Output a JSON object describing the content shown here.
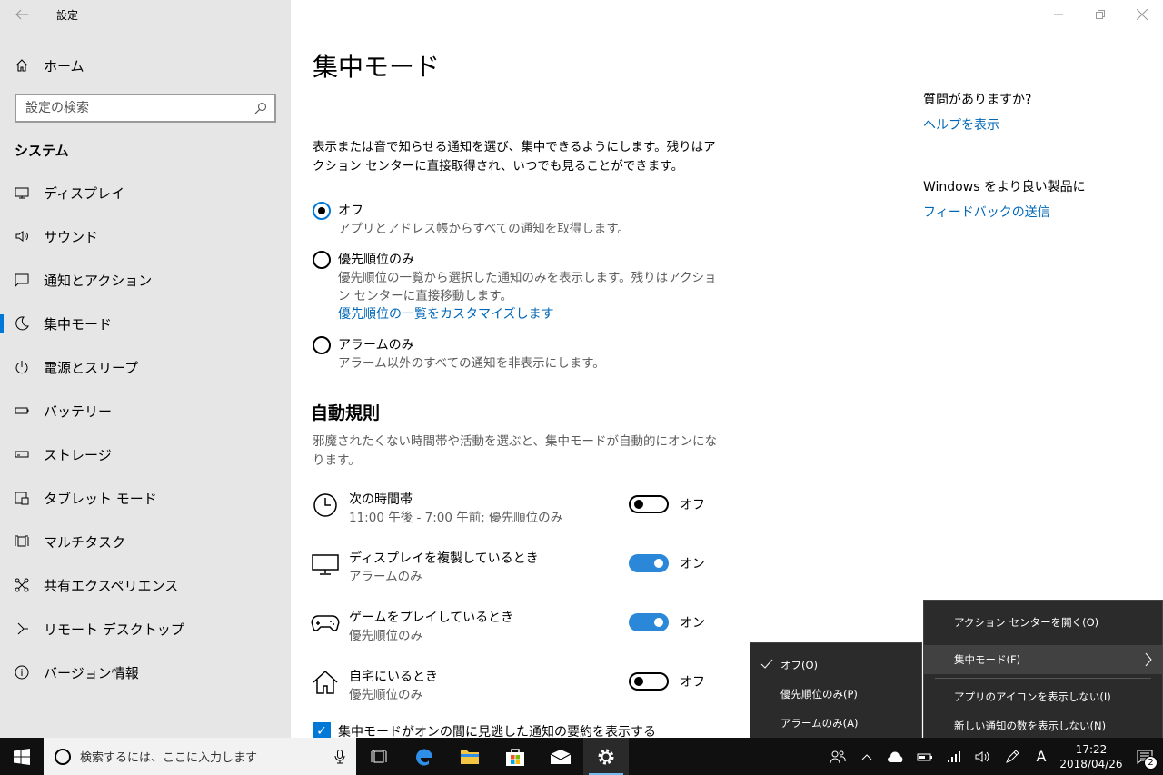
{
  "app": {
    "title": "設定"
  },
  "sidebar": {
    "home_label": "ホーム",
    "search_placeholder": "設定の検索",
    "section": "システム",
    "items": [
      {
        "label": "ディスプレイ",
        "icon": "display-icon"
      },
      {
        "label": "サウンド",
        "icon": "speaker-icon"
      },
      {
        "label": "通知とアクション",
        "icon": "message-icon"
      },
      {
        "label": "集中モード",
        "icon": "moon-icon",
        "active": true
      },
      {
        "label": "電源とスリープ",
        "icon": "power-icon"
      },
      {
        "label": "バッテリー",
        "icon": "battery-icon"
      },
      {
        "label": "ストレージ",
        "icon": "storage-icon"
      },
      {
        "label": "タブレット モード",
        "icon": "tablet-icon"
      },
      {
        "label": "マルチタスク",
        "icon": "multitask-icon"
      },
      {
        "label": "共有エクスペリエンス",
        "icon": "share-icon"
      },
      {
        "label": "リモート デスクトップ",
        "icon": "remote-icon"
      },
      {
        "label": "バージョン情報",
        "icon": "info-icon"
      }
    ]
  },
  "main": {
    "title": "集中モード",
    "description": "表示または音で知らせる通知を選び、集中できるようにします。残りはアクション センターに直接取得され、いつでも見ることができます。",
    "options": [
      {
        "label": "オフ",
        "sub": "アプリとアドレス帳からすべての通知を取得します。",
        "checked": true
      },
      {
        "label": "優先順位のみ",
        "sub": "優先順位の一覧から選択した通知のみを表示します。残りはアクション センターに直接移動します。",
        "link": "優先順位の一覧をカスタマイズします"
      },
      {
        "label": "アラームのみ",
        "sub": "アラーム以外のすべての通知を非表示にします。"
      }
    ],
    "auto_rules_title": "自動規則",
    "auto_rules_desc": "邪魔されたくない時間帯や活動を選ぶと、集中モードが自動的にオンになります。",
    "rules": [
      {
        "label": "次の時間帯",
        "sub": "11:00 午後 - 7:00 午前; 優先順位のみ",
        "state": "オフ",
        "on": false,
        "icon": "clock-icon"
      },
      {
        "label": "ディスプレイを複製しているとき",
        "sub": "アラームのみ",
        "state": "オン",
        "on": true,
        "icon": "monitor-icon"
      },
      {
        "label": "ゲームをプレイしているとき",
        "sub": "優先順位のみ",
        "state": "オン",
        "on": true,
        "icon": "gamepad-icon"
      },
      {
        "label": "自宅にいるとき",
        "sub": "優先順位のみ",
        "state": "オフ",
        "on": false,
        "icon": "home-icon"
      }
    ],
    "checkbox_label": "集中モードがオンの間に見逃した通知の要約を表示する"
  },
  "right": {
    "q_title": "質問がありますか?",
    "help_link": "ヘルプを表示",
    "better_title": "Windows をより良い製品に",
    "feedback_link": "フィードバックの送信"
  },
  "context_menu": {
    "items": [
      "アクション センターを開く(O)",
      "集中モード(F)",
      "アプリのアイコンを表示しない(I)",
      "新しい通知の数を表示しない(N)"
    ],
    "submenu": [
      "オフ(O)",
      "優先順位のみ(P)",
      "アラームのみ(A)"
    ]
  },
  "taskbar": {
    "search_text": "検索するには、ここに入力します",
    "time": "17:22",
    "date": "2018/04/26",
    "notif_count": "2",
    "ime": "A"
  },
  "colors": {
    "accent": "#0078d7",
    "link": "#0067b8",
    "toggle_on": "#2b88d8"
  }
}
